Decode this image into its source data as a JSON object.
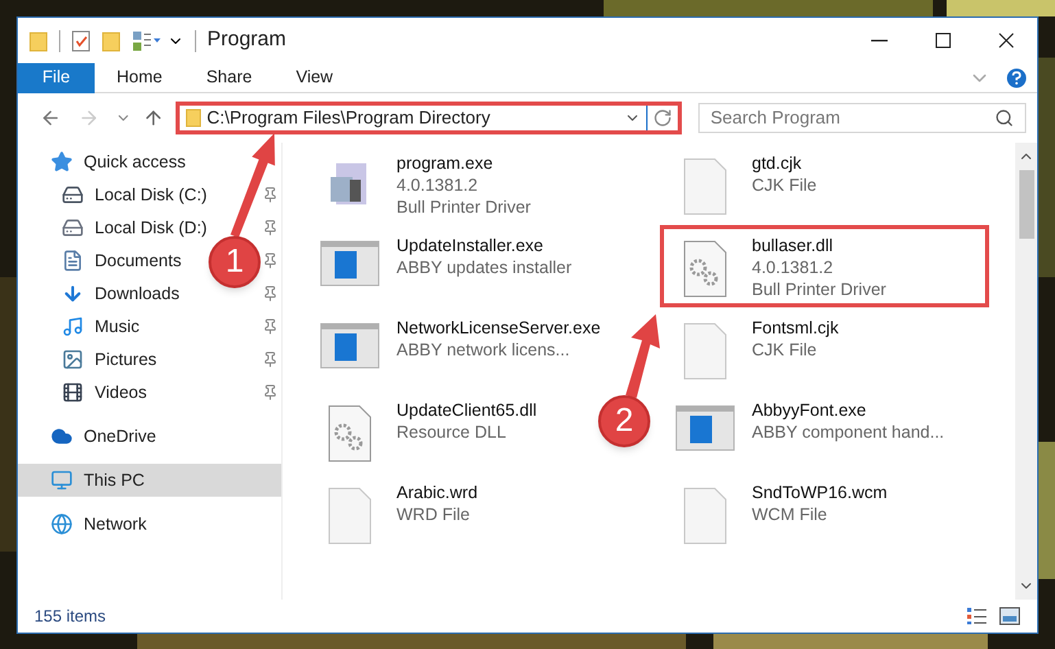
{
  "window": {
    "title": "Program"
  },
  "ribbon_tabs": [
    {
      "label": "File",
      "selected": true
    },
    {
      "label": "Home",
      "selected": false
    },
    {
      "label": "Share",
      "selected": false
    },
    {
      "label": "View",
      "selected": false
    }
  ],
  "address_bar": {
    "path": "C:\\Program Files\\Program Directory",
    "highlighted": true
  },
  "search": {
    "placeholder": "Search Program"
  },
  "sidebar": {
    "items": [
      {
        "label": "Quick access",
        "kind": "quick",
        "selected": false,
        "children": [
          {
            "label": "Local Disk (C:)",
            "kind": "diskc",
            "pinned": true,
            "selected": false
          },
          {
            "label": "Local Disk (D:)",
            "kind": "disk",
            "pinned": true,
            "selected": false
          },
          {
            "label": "Documents",
            "kind": "documents",
            "pinned": true,
            "selected": false
          },
          {
            "label": "Downloads",
            "kind": "downloads",
            "pinned": true,
            "selected": false
          },
          {
            "label": "Music",
            "kind": "music",
            "pinned": true,
            "selected": false
          },
          {
            "label": "Pictures",
            "kind": "pictures",
            "pinned": true,
            "selected": false
          },
          {
            "label": "Videos",
            "kind": "videos",
            "pinned": true,
            "selected": false
          }
        ]
      },
      {
        "label": "OneDrive",
        "kind": "cloud",
        "selected": false
      },
      {
        "label": "This PC",
        "kind": "pc",
        "selected": true
      },
      {
        "label": "Network",
        "kind": "network",
        "selected": false
      }
    ]
  },
  "files": [
    {
      "kind": "app",
      "highlighted": false,
      "name": "program.exe",
      "lines": [
        "4.0.1381.2",
        "Bull Printer Driver"
      ]
    },
    {
      "kind": "doc",
      "highlighted": false,
      "name": "gtd.cjk",
      "lines": [
        "CJK File"
      ]
    },
    {
      "kind": "window",
      "highlighted": false,
      "name": "UpdateInstaller.exe",
      "lines": [
        "ABBY updates installer"
      ]
    },
    {
      "kind": "gear",
      "highlighted": true,
      "name": "bullaser.dll",
      "lines": [
        "4.0.1381.2",
        "Bull Printer Driver"
      ]
    },
    {
      "kind": "window",
      "highlighted": false,
      "name": "NetworkLicenseServer.exe",
      "lines": [
        "ABBY network licens..."
      ]
    },
    {
      "kind": "doc",
      "highlighted": false,
      "name": "Fontsml.cjk",
      "lines": [
        "CJK File"
      ]
    },
    {
      "kind": "gear",
      "highlighted": false,
      "name": "UpdateClient65.dll",
      "lines": [
        "Resource DLL"
      ]
    },
    {
      "kind": "window",
      "highlighted": false,
      "name": "AbbyyFont.exe",
      "lines": [
        "ABBY component hand..."
      ]
    },
    {
      "kind": "doc",
      "highlighted": false,
      "name": "Arabic.wrd",
      "lines": [
        "WRD File"
      ]
    },
    {
      "kind": "doc",
      "highlighted": false,
      "name": "SndToWP16.wcm",
      "lines": [
        "WCM File"
      ]
    }
  ],
  "status_bar": {
    "count": "155 items"
  },
  "annotations": [
    {
      "label": "1"
    },
    {
      "label": "2"
    }
  ]
}
